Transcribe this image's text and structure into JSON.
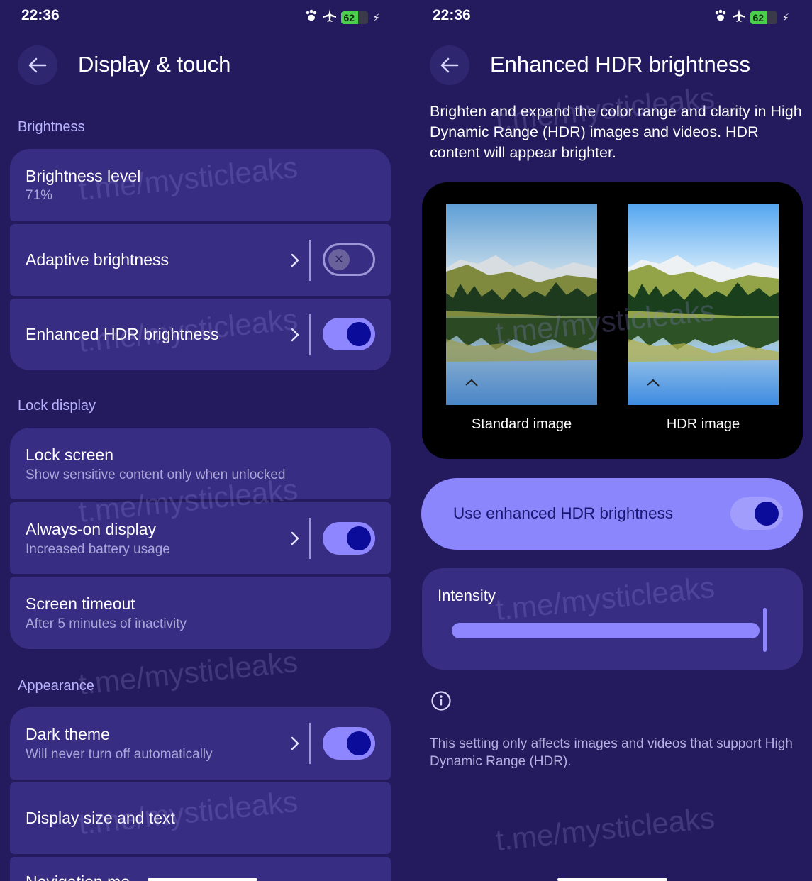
{
  "status_bar": {
    "time": "22:36",
    "battery": "62",
    "icons": [
      "paw-icon",
      "airplane-icon",
      "battery-icon",
      "charging-bolt-icon"
    ]
  },
  "left": {
    "title": "Display & touch",
    "sections": {
      "brightness": "Brightness",
      "lock_display": "Lock display",
      "appearance": "Appearance"
    },
    "items": {
      "brightness_level": {
        "title": "Brightness level",
        "subtitle": "71%"
      },
      "adaptive_brightness": {
        "title": "Adaptive brightness",
        "toggle": false
      },
      "enhanced_hdr": {
        "title": "Enhanced HDR brightness",
        "toggle": true
      },
      "lock_screen": {
        "title": "Lock screen",
        "subtitle": "Show sensitive content only when unlocked"
      },
      "always_on": {
        "title": "Always-on display",
        "subtitle": "Increased battery usage",
        "toggle": true
      },
      "screen_timeout": {
        "title": "Screen timeout",
        "subtitle": "After 5 minutes of inactivity"
      },
      "dark_theme": {
        "title": "Dark theme",
        "subtitle": "Will never turn off automatically",
        "toggle": true
      },
      "display_size": {
        "title": "Display size and text"
      },
      "navigation_mode": {
        "title": "Navigation mo"
      }
    }
  },
  "right": {
    "title": "Enhanced HDR brightness",
    "description": "Brighten and expand the color range and clarity in High Dynamic Range (HDR) images and videos. HDR content will appear brighter.",
    "preview": {
      "standard_caption": "Standard image",
      "hdr_caption": "HDR image"
    },
    "use_hdr": {
      "label": "Use enhanced HDR brightness",
      "toggle": true
    },
    "intensity": {
      "label": "Intensity",
      "value_percent": 100
    },
    "note": "This setting only affects images and videos that support High Dynamic Range (HDR)."
  },
  "watermark": "t.me/mysticleaks",
  "colors": {
    "background": "#241a5e",
    "card": "#372d83",
    "accent": "#8d86ff",
    "knob": "#0c0c9a",
    "section_label": "#b7b3ff"
  }
}
